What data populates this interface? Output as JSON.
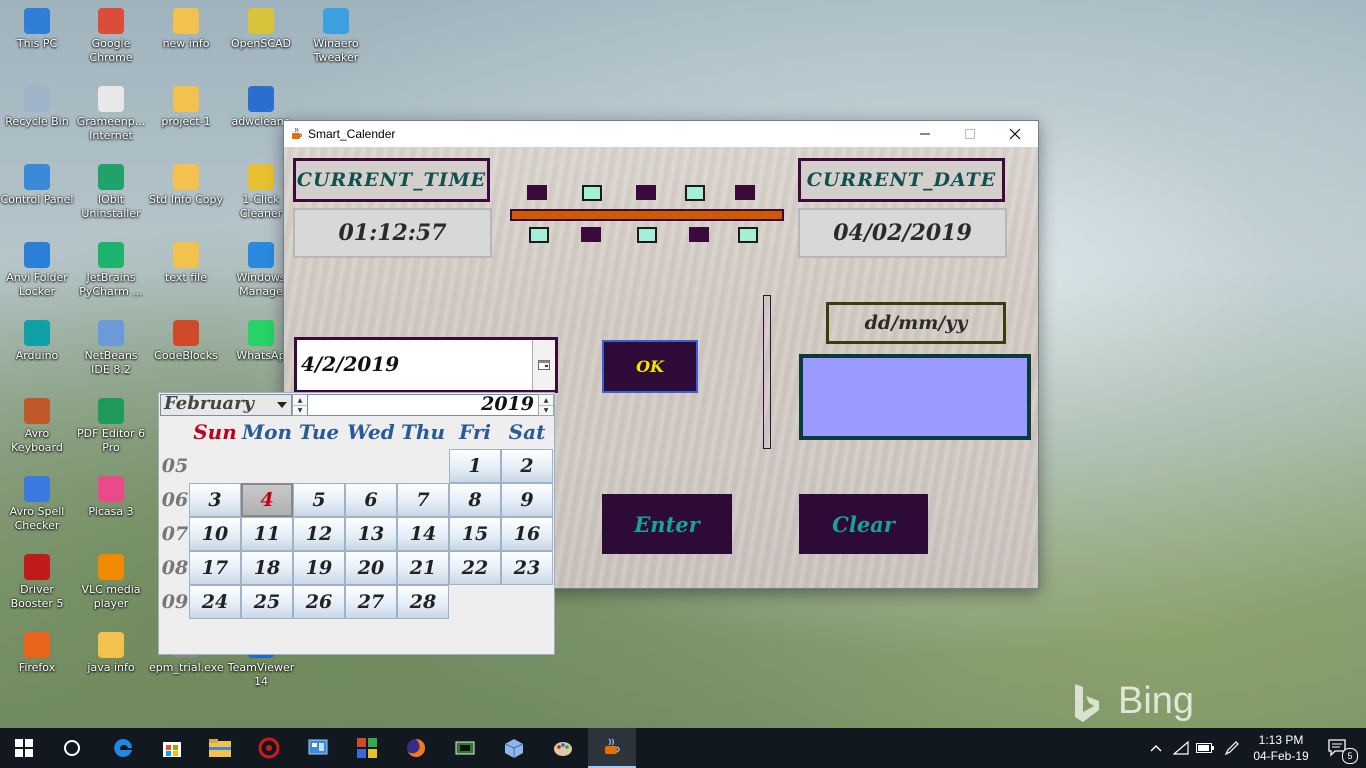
{
  "desktop": {
    "icons": [
      {
        "label": "This PC",
        "color": "#2f7fd8"
      },
      {
        "label": "Google Chrome",
        "color": "#dd4b39"
      },
      {
        "label": "new info",
        "color": "#f2c14e"
      },
      {
        "label": "OpenSCAD",
        "color": "#d9c33a"
      },
      {
        "label": "Winaero Tweaker",
        "color": "#3aa0e0"
      },
      {
        "label": "Recycle Bin",
        "color": "#9fb4c8"
      },
      {
        "label": "Grameenp... Internet",
        "color": "#e8e8e8"
      },
      {
        "label": "project-1",
        "color": "#f2c14e"
      },
      {
        "label": "adwcleane",
        "color": "#2a6fd0"
      },
      {
        "label": "Control Panel",
        "color": "#3a8ad8"
      },
      {
        "label": "IObit Uninstaller",
        "color": "#1fa36a"
      },
      {
        "label": "Std Info Copy",
        "color": "#f2c14e"
      },
      {
        "label": "1-Click Cleaner",
        "color": "#e8c030"
      },
      {
        "label": "Anvi Folder Locker",
        "color": "#2a7fd8"
      },
      {
        "label": "JetBrains PyCharm ...",
        "color": "#1cb36a"
      },
      {
        "label": "text file",
        "color": "#f2c14e"
      },
      {
        "label": "Windows Manage",
        "color": "#2a8ae0"
      },
      {
        "label": "Arduino",
        "color": "#12a0a8"
      },
      {
        "label": "NetBeans IDE 8.2",
        "color": "#6a9ad8"
      },
      {
        "label": "CodeBlocks",
        "color": "#d04a2a"
      },
      {
        "label": "WhatsAp",
        "color": "#25d366"
      },
      {
        "label": "Avro Keyboard",
        "color": "#c0582a"
      },
      {
        "label": "PDF Editor 6 Pro",
        "color": "#1f9a5a"
      },
      {
        "label": "Avro Spell Checker",
        "color": "#3a7ae0"
      },
      {
        "label": "Picasa 3",
        "color": "#e84a8a"
      },
      {
        "label": "Driver Booster 5",
        "color": "#c01a1a"
      },
      {
        "label": "VLC media player",
        "color": "#f08a00"
      },
      {
        "label": "Firefox",
        "color": "#e8641a"
      },
      {
        "label": "java info",
        "color": "#f2c14e"
      },
      {
        "label": "epm_trial.exe",
        "color": "#888888"
      },
      {
        "label": "TeamViewer 14",
        "color": "#1a6ad8"
      }
    ],
    "watermark": "Bing"
  },
  "window": {
    "title": "Smart_Calender",
    "current_time_label": "CURRENT_TIME",
    "current_time_value": "01:12:57",
    "current_date_label": "CURRENT_DATE",
    "current_date_value": "04/02/2019",
    "date_input_value": "4/2/2019",
    "ok_label": "OK",
    "format_label": "dd/mm/yy",
    "enter_label": "Enter",
    "clear_label": "Clear",
    "result_value": "",
    "colors": {
      "accent_dark": "#2e0a37",
      "teal_text": "#17a39a",
      "ok_text": "#f2e600",
      "result_bg": "#9b9bff",
      "bar": "#d05a00"
    }
  },
  "calendar": {
    "month": "February",
    "year": "2019",
    "weekdays": [
      "Sun",
      "Mon",
      "Tue",
      "Wed",
      "Thu",
      "Fri",
      "Sat"
    ],
    "weeks": [
      "05",
      "06",
      "07",
      "08",
      "09"
    ],
    "first_weekday_index": 5,
    "days_in_month": 28,
    "selected_day": 4
  },
  "taskbar": {
    "time": "1:13 PM",
    "date": "04-Feb-19",
    "notification_count": "5"
  }
}
